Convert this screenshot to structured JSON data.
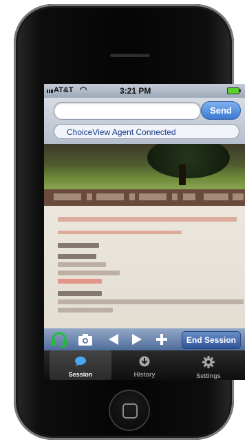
{
  "status_bar": {
    "carrier": "AT&T",
    "time": "3:21 PM"
  },
  "message_bar": {
    "input_value": "",
    "send_label": "Send"
  },
  "agent_status": "ChoiceView Agent Connected",
  "toolbar": {
    "end_session_label": "End Session",
    "icons": [
      "headset-icon",
      "camera-icon",
      "back-icon",
      "forward-icon",
      "add-icon"
    ]
  },
  "tabs": [
    {
      "label": "Session",
      "icon": "chat-bubble-icon",
      "active": true
    },
    {
      "label": "History",
      "icon": "download-icon",
      "active": false
    },
    {
      "label": "Settings",
      "icon": "gear-icon",
      "active": false
    }
  ],
  "colors": {
    "accent_blue": "#3d79d3",
    "headset_green": "#1fbf35",
    "battery_green": "#5bd12c"
  }
}
